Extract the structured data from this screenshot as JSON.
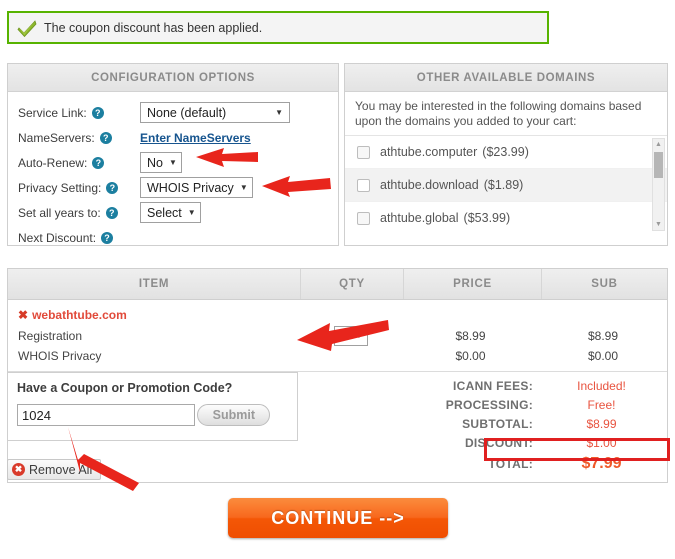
{
  "alert": {
    "icon": "green-check-icon",
    "message": "The coupon discount has been applied."
  },
  "config": {
    "title": "CONFIGURATION OPTIONS",
    "rows": [
      {
        "label": "Service Link:",
        "control": "select",
        "value": "None (default)"
      },
      {
        "label": "NameServers:",
        "control": "link",
        "value": "Enter NameServers"
      },
      {
        "label": "Auto-Renew:",
        "control": "select",
        "value": "No"
      },
      {
        "label": "Privacy Setting:",
        "control": "select",
        "value": "WHOIS Privacy"
      },
      {
        "label": "Set all years to:",
        "control": "select",
        "value": "Select"
      },
      {
        "label": "Next Discount:",
        "control": "none",
        "value": ""
      }
    ],
    "help_glyph": "?"
  },
  "domains": {
    "title": "OTHER AVAILABLE DOMAINS",
    "intro": "You may be interested in the following domains based upon the domains you added to your cart:",
    "items": [
      {
        "name": "athtube.computer",
        "price": "($23.99)"
      },
      {
        "name": "athtube.download",
        "price": "($1.89)"
      },
      {
        "name": "athtube.global",
        "price": "($53.99)"
      }
    ],
    "scroll_up": "▲",
    "scroll_down": "▼"
  },
  "cart": {
    "columns": [
      "ITEM",
      "QTY",
      "PRICE",
      "SUB"
    ],
    "domain": {
      "remove_glyph": "✖",
      "name": "webathtube.com"
    },
    "lines": [
      {
        "item": "Registration",
        "qty": "1",
        "price": "$8.99",
        "sub": "$8.99",
        "has_qty_select": true
      },
      {
        "item": "WHOIS Privacy",
        "qty": "",
        "price": "$0.00",
        "sub": "$0.00",
        "has_qty_select": false
      }
    ]
  },
  "coupon": {
    "title": "Have a Coupon or Promotion Code?",
    "value": "1024",
    "placeholder": "",
    "submit_label": "Submit"
  },
  "remove_all": {
    "glyph": "✖",
    "label": "Remove All"
  },
  "totals": {
    "rows": [
      {
        "label": "ICANN FEES:",
        "value": "Included!"
      },
      {
        "label": "PROCESSING:",
        "value": "Free!"
      },
      {
        "label": "SUBTOTAL:",
        "value": "$8.99"
      },
      {
        "label": "DISCOUNT:",
        "value": "$1.00"
      },
      {
        "label": "TOTAL:",
        "value": "$7.99"
      }
    ]
  },
  "continue": {
    "label": "CONTINUE -->"
  },
  "colors": {
    "alert_border": "#57b300",
    "accent_orange": "#ef5a2a",
    "annotation_red": "#e8251c",
    "highlight_red": "#e02020",
    "link_blue": "#17558f",
    "help_teal": "#1c7fa0"
  },
  "annotations": {
    "arrows": [
      {
        "name": "arrow-auto-renew",
        "points_to": "auto-renew-select"
      },
      {
        "name": "arrow-privacy-setting",
        "points_to": "privacy-setting-select"
      },
      {
        "name": "arrow-qty",
        "points_to": "qty-select"
      },
      {
        "name": "arrow-coupon",
        "points_to": "coupon-input"
      }
    ],
    "highlight_box": {
      "name": "discount-highlight",
      "targets": "discount-row"
    }
  }
}
